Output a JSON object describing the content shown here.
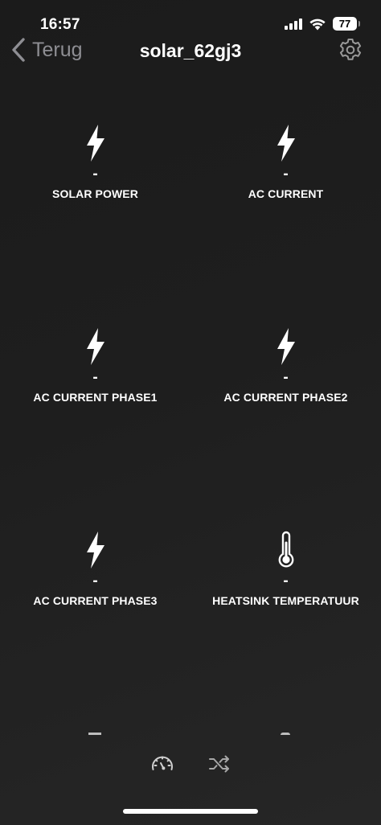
{
  "status_bar": {
    "time": "16:57",
    "battery": "77",
    "icons": [
      "signal-icon",
      "wifi-icon",
      "battery-icon"
    ]
  },
  "nav": {
    "back_label": "Terug",
    "title": "solar_62gj3",
    "back_icon": "chevron-left-icon",
    "settings_icon": "gear-icon"
  },
  "tiles": [
    {
      "label": "SOLAR POWER",
      "value": "-",
      "icon": "lightning-icon"
    },
    {
      "label": "AC CURRENT",
      "value": "-",
      "icon": "lightning-icon"
    },
    {
      "label": "AC CURRENT PHASE1",
      "value": "-",
      "icon": "lightning-icon"
    },
    {
      "label": "AC CURRENT PHASE2",
      "value": "-",
      "icon": "lightning-icon"
    },
    {
      "label": "AC CURRENT PHASE3",
      "value": "-",
      "icon": "lightning-icon"
    },
    {
      "label": "HEATSINK TEMPERATUUR",
      "value": "-",
      "icon": "thermometer-icon"
    }
  ],
  "tab_bar": {
    "tabs": [
      {
        "icon": "speedometer-icon"
      },
      {
        "icon": "shuffle-icon"
      }
    ]
  },
  "colors": {
    "background": "#1b1b1b",
    "text": "#ffffff",
    "back_button": "#8e8e93",
    "tab_icon": "#bdbdbd"
  }
}
